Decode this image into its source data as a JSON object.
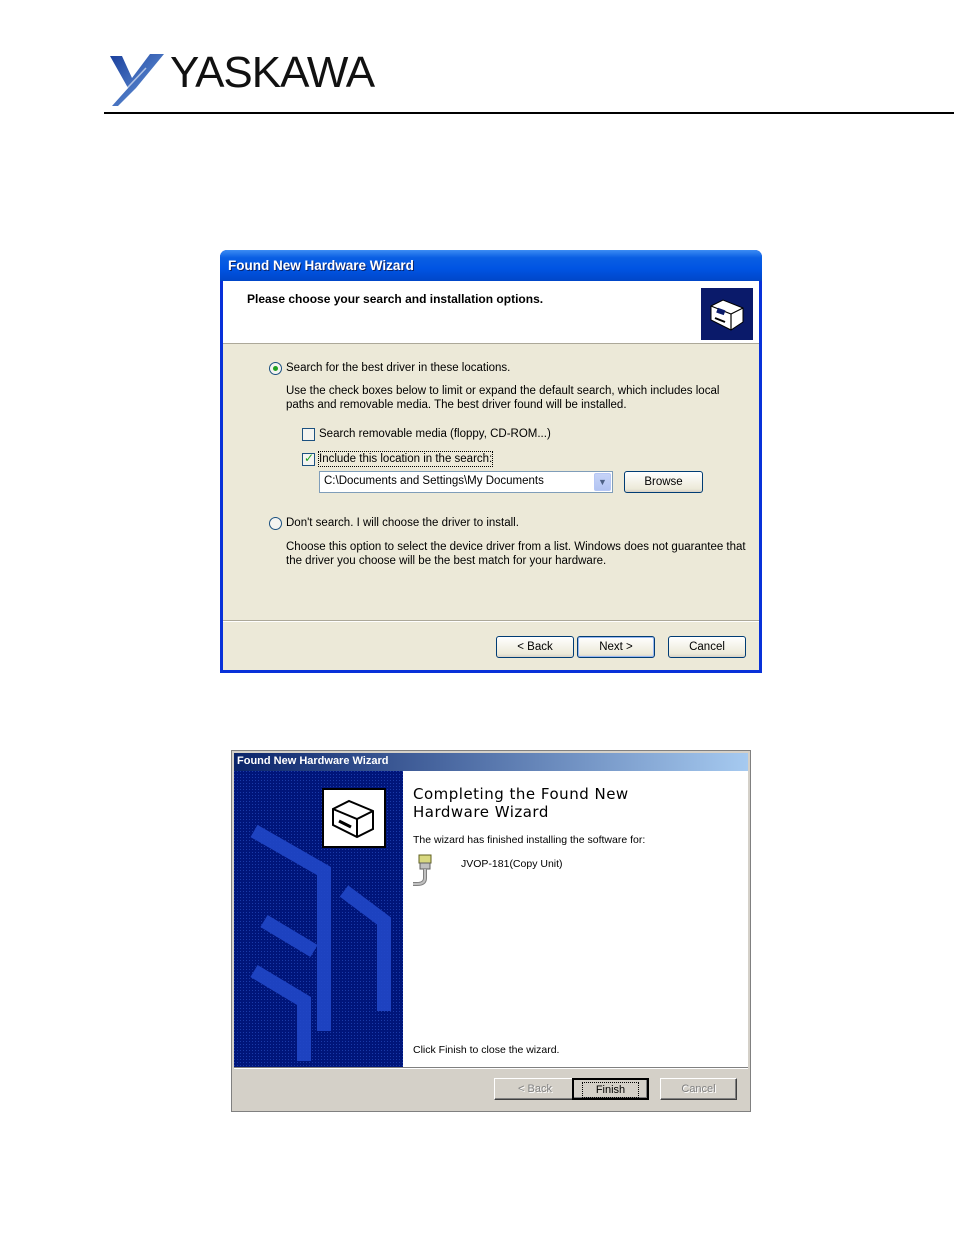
{
  "header": {
    "brand_text": "YASKAWA"
  },
  "wizard_one": {
    "title": "Found New Hardware Wizard",
    "heading": "Please choose your search and installation options.",
    "option_search": {
      "label": "Search for the best driver in these locations.",
      "selected": true,
      "description_line1": "Use the check boxes below to limit or expand the default search, which includes local",
      "description_line2": "paths and removable media. The best driver found will be installed."
    },
    "check_removable": {
      "label": "Search removable media (floppy, CD-ROM...)",
      "checked": false
    },
    "check_location": {
      "label": "Include this location in the search:",
      "checked": true
    },
    "location_value": "C:\\Documents and Settings\\My Documents",
    "browse_label": "Browse",
    "option_dont_search": {
      "label": "Don't search. I will choose the driver to install.",
      "selected": false,
      "description_line1": "Choose this option to select the device driver from a list.  Windows does not guarantee that",
      "description_line2": "the driver you choose will be the best match for your hardware."
    },
    "buttons": {
      "back": "< Back",
      "next": "Next >",
      "cancel": "Cancel"
    }
  },
  "wizard_two": {
    "title": "Found New Hardware Wizard",
    "heading_line1": "Completing the Found New",
    "heading_line2": "Hardware Wizard",
    "finished_text": "The wizard has finished installing the software for:",
    "device_name": "JVOP-181(Copy Unit)",
    "close_text": "Click Finish to close the wizard.",
    "buttons": {
      "back": "< Back",
      "finish": "Finish",
      "cancel": "Cancel"
    }
  },
  "colors": {
    "xp_title_blue": "#0054e3",
    "xp_dialog_bg": "#ece9d8",
    "classic_sidebar": "#00157a",
    "classic_dialog_bg": "#d4d0c8"
  }
}
